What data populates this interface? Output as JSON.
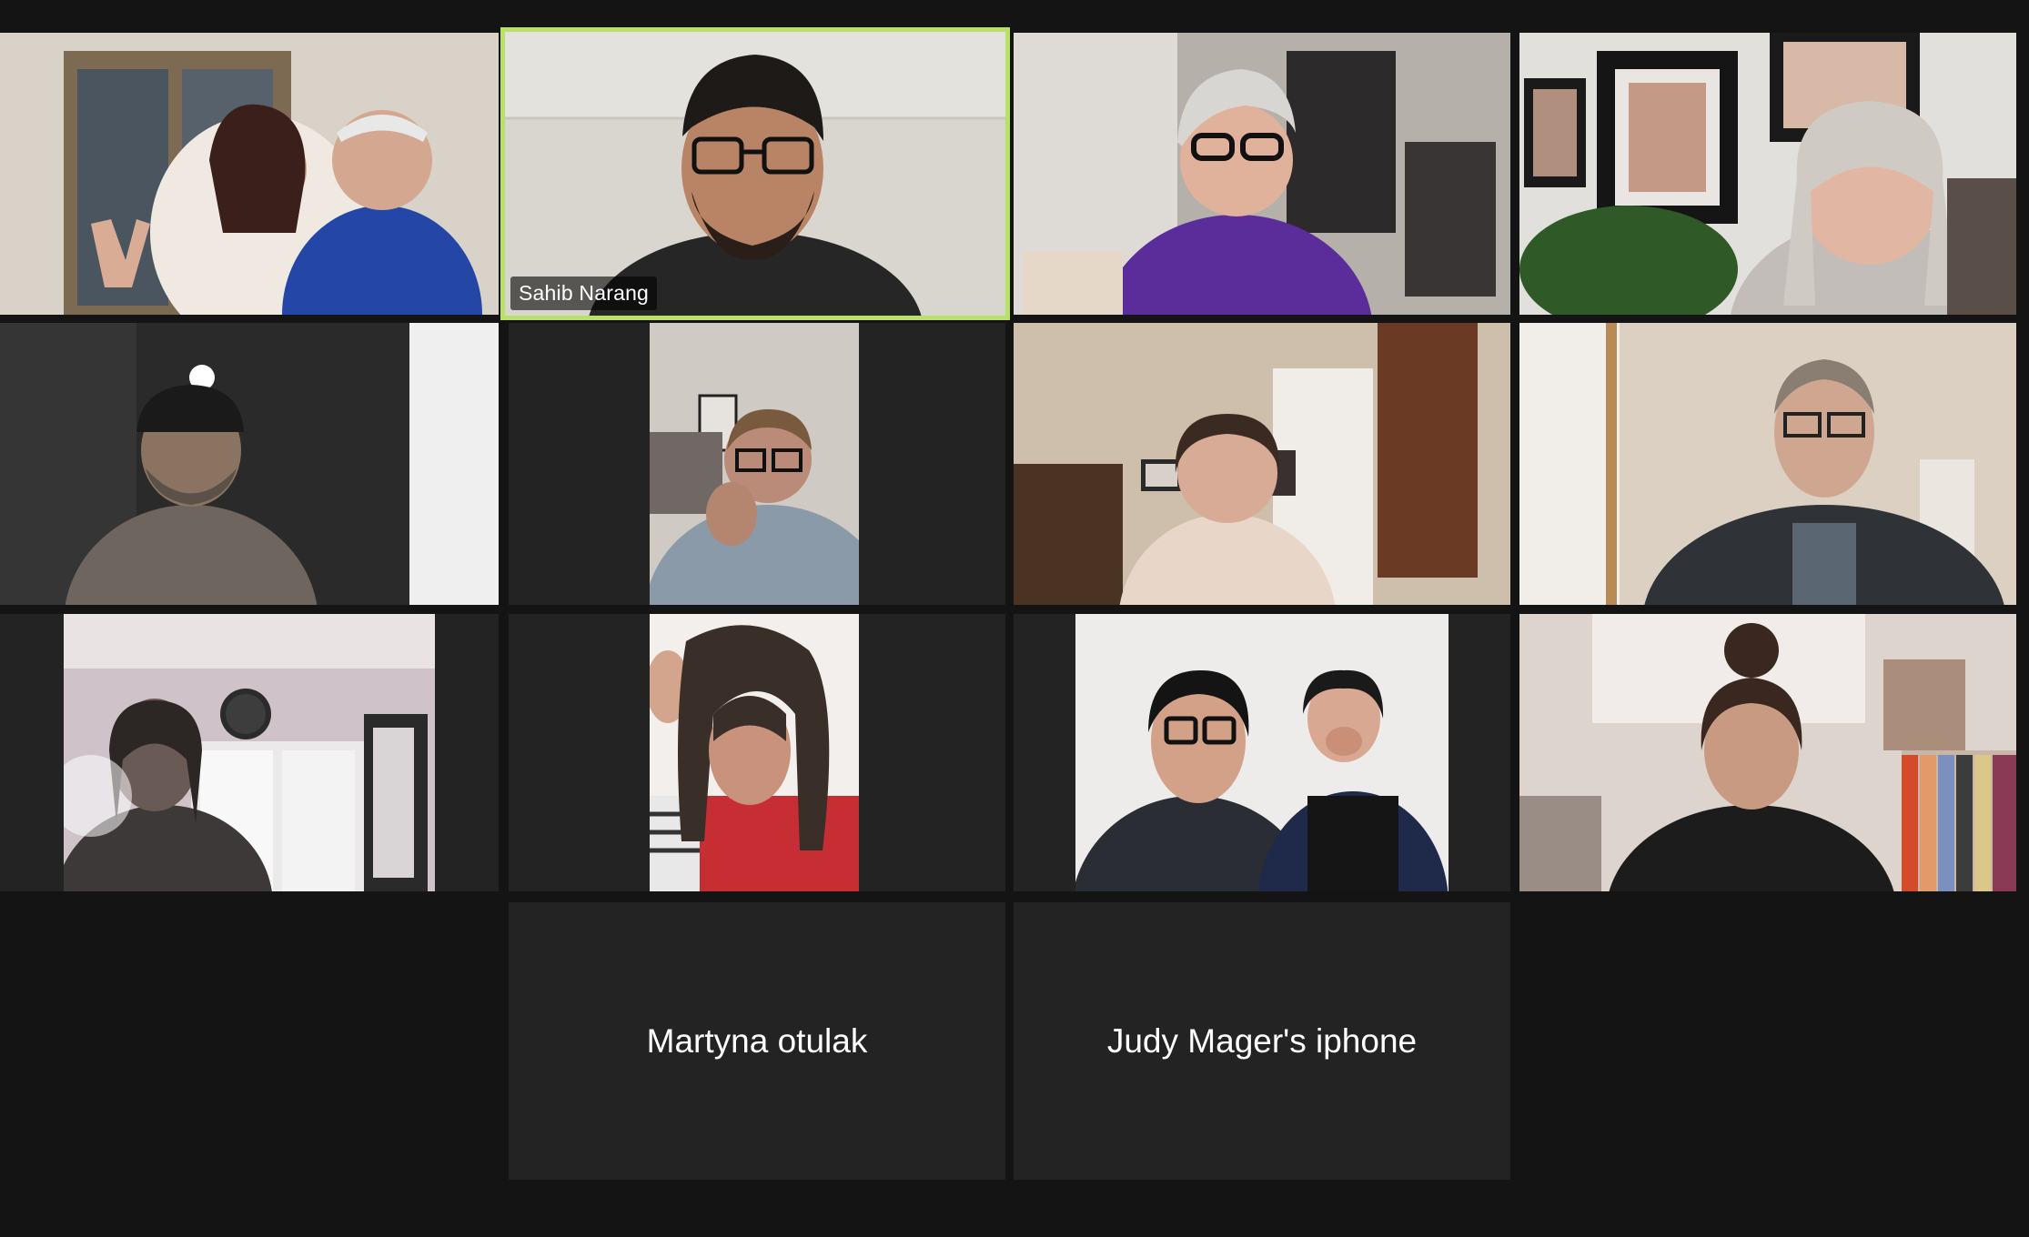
{
  "gallery": {
    "speaker_name": "Sahib Narang",
    "no_video_participants": [
      {
        "name": "Martyna otulak"
      },
      {
        "name": "Judy Mager's iphone"
      }
    ]
  },
  "colors": {
    "background": "#141414",
    "tile_background": "#232323",
    "active_speaker_border": "#b9e068"
  }
}
